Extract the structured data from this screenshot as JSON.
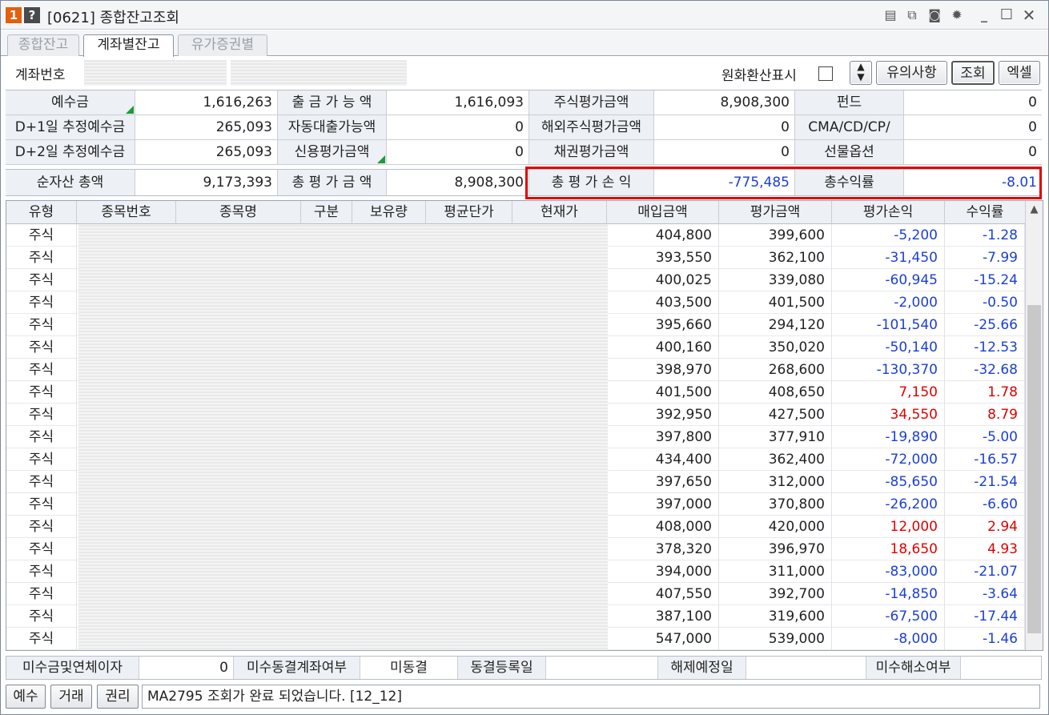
{
  "window": {
    "badge_num": "1",
    "badge_help": "?",
    "title": "[0621] 종합잔고조회"
  },
  "title_icons": [
    "memo-icon",
    "copy-icon",
    "camera-icon",
    "gear-icon",
    "minimize-icon",
    "maximize-icon",
    "close-icon"
  ],
  "tabs": [
    "종합잔고",
    "계좌별잔고",
    "유가증권별"
  ],
  "account": {
    "label": "계좌번호",
    "fx_label": "원화환산표시"
  },
  "buttons": {
    "notice": "유의사항",
    "query": "조회",
    "excel": "엑셀"
  },
  "summary": [
    [
      "예수금",
      "1,616,263",
      "출 금 가 능 액",
      "1,616,093",
      "주식평가금액",
      "8,908,300",
      "펀드",
      "0"
    ],
    [
      "D+1일 추정예수금",
      "265,093",
      "자동대출가능액",
      "0",
      "해외주식평가금액",
      "0",
      "CMA/CD/CP/",
      "0"
    ],
    [
      "D+2일 추정예수금",
      "265,093",
      "신용평가금액",
      "0",
      "채권평가금액",
      "0",
      "선물옵션",
      "0"
    ]
  ],
  "totals": {
    "net_label": "순자산 총액",
    "net_value": "9,173,393",
    "eval_label": "총 평 가 금 액",
    "eval_value": "8,908,300",
    "pl_label": "총 평 가 손 익",
    "pl_value": "-775,485",
    "rate_label": "총수익률",
    "rate_value": "-8.01"
  },
  "grid": {
    "headers": [
      "유형",
      "종목번호",
      "종목명",
      "구분",
      "보유량",
      "평균단가",
      "현재가",
      "매입금액",
      "평가금액",
      "평가손익",
      "수익률"
    ],
    "rows": [
      [
        "주식",
        "404,800",
        "399,600",
        "-5,200",
        "-1.28"
      ],
      [
        "주식",
        "393,550",
        "362,100",
        "-31,450",
        "-7.99"
      ],
      [
        "주식",
        "400,025",
        "339,080",
        "-60,945",
        "-15.24"
      ],
      [
        "주식",
        "403,500",
        "401,500",
        "-2,000",
        "-0.50"
      ],
      [
        "주식",
        "395,660",
        "294,120",
        "-101,540",
        "-25.66"
      ],
      [
        "주식",
        "400,160",
        "350,020",
        "-50,140",
        "-12.53"
      ],
      [
        "주식",
        "398,970",
        "268,600",
        "-130,370",
        "-32.68"
      ],
      [
        "주식",
        "401,500",
        "408,650",
        "7,150",
        "1.78"
      ],
      [
        "주식",
        "392,950",
        "427,500",
        "34,550",
        "8.79"
      ],
      [
        "주식",
        "397,800",
        "377,910",
        "-19,890",
        "-5.00"
      ],
      [
        "주식",
        "434,400",
        "362,400",
        "-72,000",
        "-16.57"
      ],
      [
        "주식",
        "397,650",
        "312,000",
        "-85,650",
        "-21.54"
      ],
      [
        "주식",
        "397,000",
        "370,800",
        "-26,200",
        "-6.60"
      ],
      [
        "주식",
        "408,000",
        "420,000",
        "12,000",
        "2.94"
      ],
      [
        "주식",
        "378,320",
        "396,970",
        "18,650",
        "4.93"
      ],
      [
        "주식",
        "394,000",
        "311,000",
        "-83,000",
        "-21.07"
      ],
      [
        "주식",
        "407,550",
        "392,700",
        "-14,850",
        "-3.64"
      ],
      [
        "주식",
        "387,100",
        "319,600",
        "-67,500",
        "-17.44"
      ],
      [
        "주식",
        "547,000",
        "539,000",
        "-8,000",
        "-1.46"
      ]
    ]
  },
  "footer": {
    "c1": "미수금및연체이자",
    "c2": "0",
    "c3": "미수동결계좌여부",
    "c4": "미동결",
    "c5": "동결등록일",
    "c6": "",
    "c7": "해제예정일",
    "c8": "",
    "c9": "미수해소여부",
    "c10": ""
  },
  "status": {
    "b1": "예수",
    "b2": "거래",
    "b3": "권리",
    "message": "MA2795 조회가 완료 되었습니다. [12_12]"
  },
  "colors": {
    "negative": "#1b3fd6",
    "positive": "#e00000",
    "highlight": "#e00000"
  }
}
